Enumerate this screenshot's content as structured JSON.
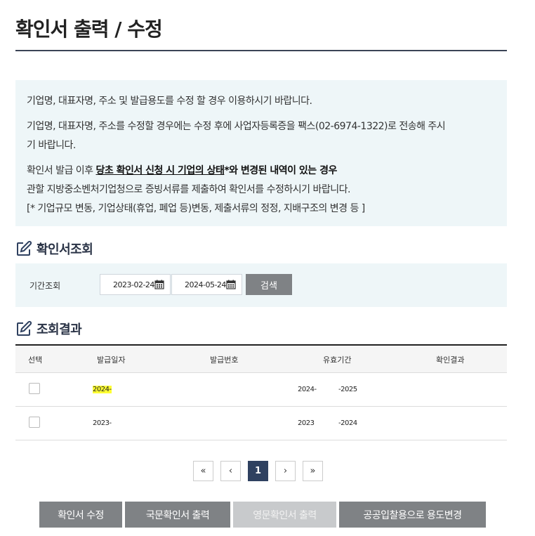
{
  "page": {
    "title": "확인서 출력 / 수정"
  },
  "notice": {
    "line1": "기업명, 대표자명, 주소 및 발급용도를 수정 할 경우 이용하시기 바랍니다.",
    "line2a": "기업명, 대표자명, 주소를 수정할 경우에는 수정 후에 사업자등록증을 팩스(02-6974-1322)로 전송해 주시",
    "line2b": "기 바랍니다.",
    "line3_prefix": "확인서 발급 이후 ",
    "line3_underlined": "당초 확인서 신청 시 기업의 상태",
    "line3_suffix": "*와 변경된 내역이 있는 경우",
    "line4": "관할 지방중소벤처기업청으로 증빙서류를 제출하여 확인서를 수정하시기 바랍니다.",
    "line5": "[* 기업규모 변동, 기업상태(휴업, 폐업 등)변동, 제출서류의 정정, 지배구조의 변경 등 ]"
  },
  "search_section": {
    "heading": "확인서조회",
    "period_label": "기간조회",
    "date_from": "2023-02-24",
    "date_to": "2024-05-24",
    "search_button": "검색"
  },
  "result_section": {
    "heading": "조회결과",
    "columns": [
      "선택",
      "발급일자",
      "발급번호",
      "유효기간",
      "확인결과"
    ],
    "rows": [
      {
        "issue_date": "2024-",
        "valid_from": "2024-",
        "valid_to": "-2025",
        "selected": false
      },
      {
        "issue_date": "2023-",
        "valid_from": "2023",
        "valid_to": "-2024",
        "selected": false
      }
    ]
  },
  "pagination": {
    "first": "«",
    "prev": "‹",
    "current": "1",
    "next": "›",
    "last": "»"
  },
  "actions": {
    "modify": "확인서 수정",
    "print_kr": "국문확인서 출력",
    "print_en": "영문확인서 출력",
    "change_usage": "공공입찰용으로 용도변경"
  },
  "icons": {
    "section_icon": "edit-icon",
    "date_icon": "calendar-icon"
  },
  "colors": {
    "accent": "#2f4160",
    "button_gray": "#7f8285",
    "panel_bg": "#eef6f8",
    "highlight": "#ffff33"
  }
}
